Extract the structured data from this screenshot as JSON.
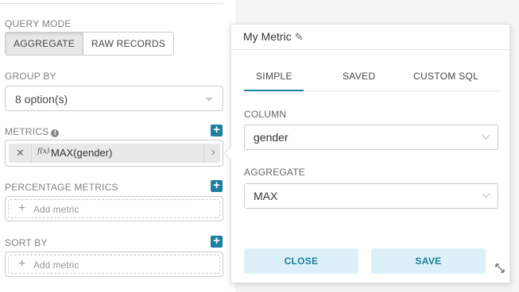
{
  "query_mode": {
    "label": "QUERY MODE",
    "options": [
      "AGGREGATE",
      "RAW RECORDS"
    ],
    "selected": "AGGREGATE"
  },
  "group_by": {
    "label": "GROUP BY",
    "value": "8 option(s)"
  },
  "metrics": {
    "label": "METRICS",
    "items": [
      {
        "fx": "f(x)",
        "name": "MAX(gender)"
      }
    ]
  },
  "percentage_metrics": {
    "label": "PERCENTAGE METRICS",
    "placeholder": "Add metric"
  },
  "sort_by": {
    "label": "SORT BY",
    "placeholder": "Add metric"
  },
  "popover": {
    "title": "My Metric",
    "tabs": [
      "SIMPLE",
      "SAVED",
      "CUSTOM SQL"
    ],
    "active_tab": "SIMPLE",
    "column_label": "COLUMN",
    "column_value": "gender",
    "aggregate_label": "AGGREGATE",
    "aggregate_value": "MAX",
    "close_label": "CLOSE",
    "save_label": "SAVE"
  },
  "icons": {
    "info": "info-icon",
    "plus": "plus-icon",
    "pencil": "pencil-icon",
    "remove": "close-icon",
    "chevron_right": "chevron-right-icon",
    "chevron_down": "chevron-down-icon",
    "resize": "resize-icon"
  },
  "colors": {
    "accent": "#1f7f9e",
    "button_bg": "#dbf1f7"
  }
}
